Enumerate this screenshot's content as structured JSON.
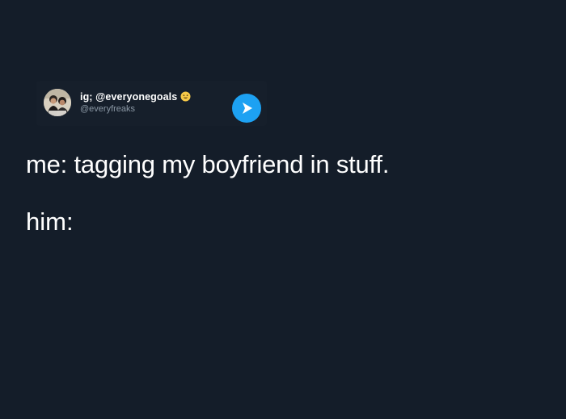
{
  "tweet": {
    "display_name": "ig; @everyonegoals",
    "handle": "@everyfreaks",
    "avatar_icon": "avatar-photo",
    "emoji_icon": "smiling-face-emoji",
    "action_icon": "play-arrow-icon",
    "accent_color": "#1da1f2"
  },
  "content": {
    "line1": "me: tagging my boyfriend in stuff.",
    "line2": "him:"
  },
  "colors": {
    "background": "#141d29",
    "text": "#ffffff",
    "handle_text": "#8b98a5"
  }
}
